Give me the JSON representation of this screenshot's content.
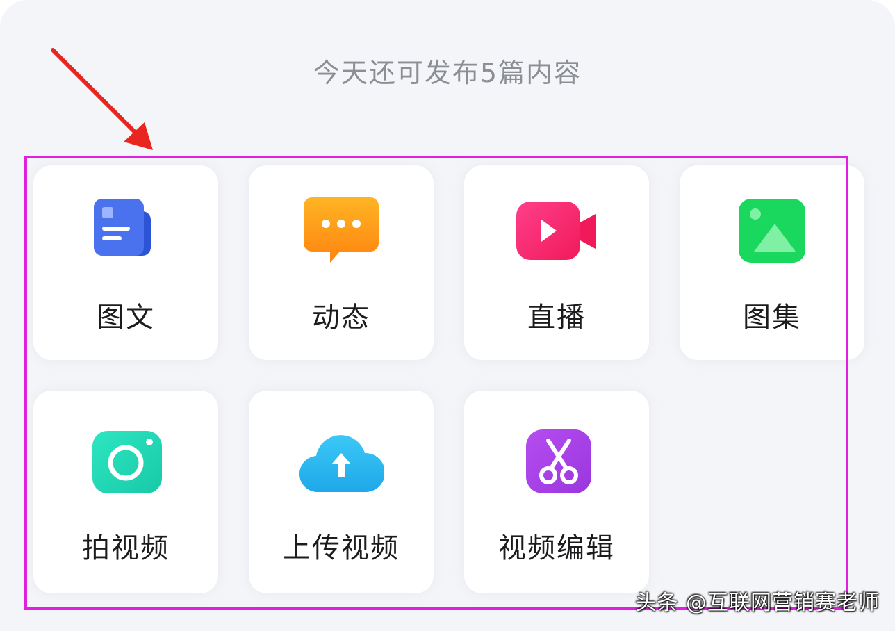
{
  "header": {
    "quota_text": "今天还可发布5篇内容"
  },
  "publish_options": [
    {
      "label": "图文",
      "icon": "article-icon",
      "color": "#3f67e8"
    },
    {
      "label": "动态",
      "icon": "chat-bubble-icon",
      "color": "#ff9a1a"
    },
    {
      "label": "直播",
      "icon": "video-camera-icon",
      "color": "#fb2a72"
    },
    {
      "label": "图集",
      "icon": "image-gallery-icon",
      "color": "#1ad85e"
    },
    {
      "label": "拍视频",
      "icon": "camera-icon",
      "color": "#22d8b3"
    },
    {
      "label": "上传视频",
      "icon": "cloud-upload-icon",
      "color": "#33bcf2"
    },
    {
      "label": "视频编辑",
      "icon": "scissors-icon",
      "color": "#a744e6"
    }
  ],
  "colors": {
    "highlight_border": "#e020e0",
    "annotation_arrow": "#e8261f"
  },
  "watermark": "头条 @互联网营销赛老师"
}
